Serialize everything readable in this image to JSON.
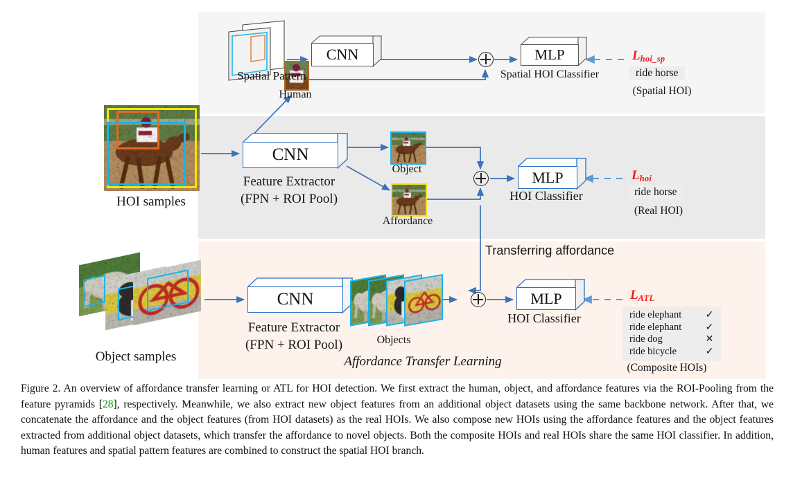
{
  "figure": {
    "label": "Figure 2.",
    "caption": "Figure 2. An overview of affordance transfer learning or ATL for HOI detection. We first extract the human, object, and affordance features via the ROI-Pooling from the feature pyramids [28], respectively. Meanwhile, we also extract new object features from an additional object datasets using the same backbone network. After that, we concatenate the affordance and the object features (from HOI datasets) as the real HOIs. We also compose new HOIs using the affordance features and the object features extracted from additional object datasets, which transfer the affordance to novel objects. Both the composite HOIs and real HOIs share the same HOI classifier. In addition, human features and spatial pattern features are combined to construct the spatial HOI branch.",
    "citation_text": "28",
    "citation_color": "#00a000"
  },
  "spatial_branch": {
    "panel_color": "#f5f5f5",
    "spatial_pattern_label": "Spatial Pattern",
    "cnn_label": "CNN",
    "human_label": "Human",
    "mlp_label": "MLP",
    "classifier_label": "Spatial HOI Classifier",
    "loss_symbol": "L",
    "loss_subscript": "hoi_sp",
    "prediction": "ride horse",
    "prediction_caption": "(Spatial HOI)"
  },
  "real_branch": {
    "panel_color": "#eaeaea",
    "input_label": "HOI samples",
    "cnn_label": "CNN",
    "extractor_line1": "Feature Extractor",
    "extractor_line2": "(FPN + ROI Pool)",
    "object_label": "Object",
    "affordance_label": "Affordance",
    "mlp_label": "MLP",
    "classifier_label": "HOI Classifier",
    "loss_symbol": "L",
    "loss_subscript": "hoi",
    "prediction": "ride horse",
    "prediction_caption": "(Real HOI)"
  },
  "atl_branch": {
    "panel_color": "#fdf2ec",
    "input_label": "Object samples",
    "cnn_label": "CNN",
    "extractor_line1": "Feature Extractor",
    "extractor_line2": "(FPN + ROI Pool)",
    "objects_label": "Objects",
    "transfer_label": "Transferring affordance",
    "mlp_label": "MLP",
    "classifier_label": "HOI Classifier",
    "panel_title": "Affordance Transfer Learning",
    "loss_symbol": "L",
    "loss_subscript": "ATL",
    "predictions": [
      {
        "text": "ride elephant",
        "mark": "✓"
      },
      {
        "text": "ride elephant",
        "mark": "✓"
      },
      {
        "text": "ride dog",
        "mark": "✕"
      },
      {
        "text": "ride bicycle",
        "mark": "✓"
      }
    ],
    "prediction_caption": "(Composite HOIs)"
  },
  "colors": {
    "arrow_blue": "#3b72b8",
    "box_blue": "#2b71c4",
    "cyan_box": "#18b4e9",
    "yellow_box": "#f2e600",
    "orange_box": "#e06b1e",
    "loss_red": "#ea1c1c",
    "chip_grey": "#ededed"
  }
}
